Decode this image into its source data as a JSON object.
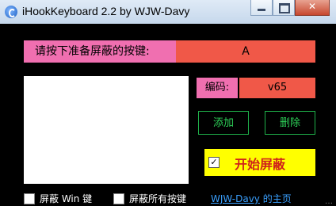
{
  "window": {
    "title": "iHookKeyboard 2.2 by WJW-Davy"
  },
  "prompt": {
    "label": "请按下准备屏蔽的按键:",
    "key": "A"
  },
  "code": {
    "label": "编码:",
    "value": "v65"
  },
  "buttons": {
    "add": "添加",
    "delete": "删除"
  },
  "start": {
    "checked_mark": "✓",
    "label": "开始屏蔽"
  },
  "options": {
    "block_win": "屏蔽 Win 键",
    "block_all": "屏蔽所有按键"
  },
  "home_link": {
    "name": "WJW-Davy",
    "suffix": " 的主页"
  },
  "watermark": "…",
  "colors": {
    "label_pink": "#f06fb0",
    "value_red": "#f05848",
    "green": "#2ed158",
    "yellow": "#ffff00"
  }
}
